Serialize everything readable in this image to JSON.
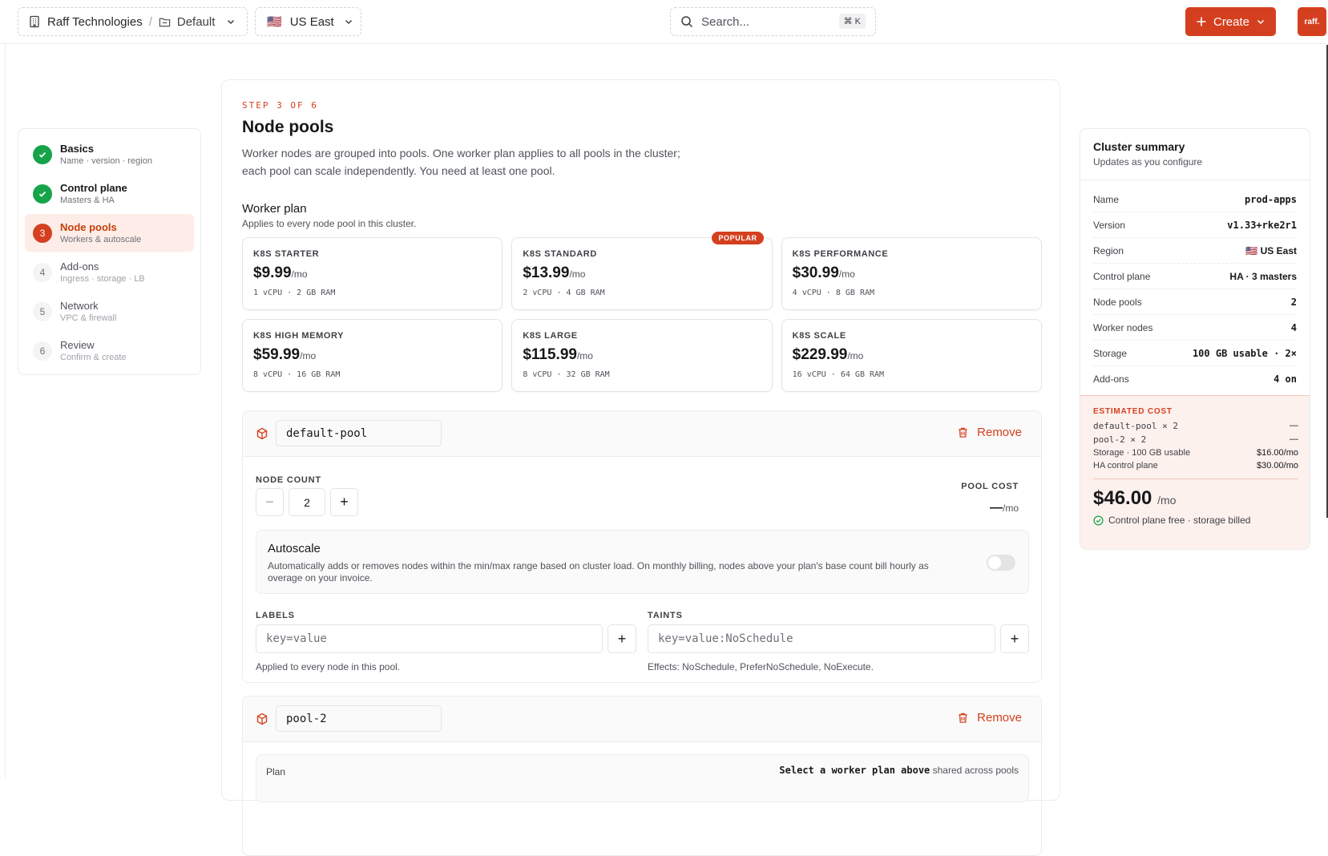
{
  "header": {
    "org": "Raff Technologies",
    "project": "Default",
    "region_flag": "🇺🇸",
    "region": "US East",
    "search_placeholder": "Search...",
    "search_shortcut": "⌘ K",
    "create_label": "Create",
    "logo_text": "raff."
  },
  "steps": [
    {
      "num": "✓",
      "title": "Basics",
      "sub": "Name · version · region",
      "state": "done"
    },
    {
      "num": "✓",
      "title": "Control plane",
      "sub": "Masters & HA",
      "state": "done"
    },
    {
      "num": "3",
      "title": "Node pools",
      "sub": "Workers & autoscale",
      "state": "current"
    },
    {
      "num": "4",
      "title": "Add-ons",
      "sub": "Ingress · storage · LB",
      "state": "todo"
    },
    {
      "num": "5",
      "title": "Network",
      "sub": "VPC & firewall",
      "state": "todo"
    },
    {
      "num": "6",
      "title": "Review",
      "sub": "Confirm & create",
      "state": "todo"
    }
  ],
  "main": {
    "eyebrow": "STEP 3 OF 6",
    "title": "Node pools",
    "description": "Worker nodes are grouped into pools. One worker plan applies to all pools in the cluster; each pool can scale independently. You need at least one pool.",
    "worker_plan_title": "Worker plan",
    "worker_plan_sub": "Applies to every node pool in this cluster.",
    "popular_label": "POPULAR",
    "plans": [
      {
        "name": "K8S STARTER",
        "price": "$9.99",
        "unit": "/mo",
        "spec": "1 vCPU · 2 GB RAM"
      },
      {
        "name": "K8S STANDARD",
        "price": "$13.99",
        "unit": "/mo",
        "spec": "2 vCPU · 4 GB RAM"
      },
      {
        "name": "K8S PERFORMANCE",
        "price": "$30.99",
        "unit": "/mo",
        "spec": "4 vCPU · 8 GB RAM"
      },
      {
        "name": "K8S HIGH MEMORY",
        "price": "$59.99",
        "unit": "/mo",
        "spec": "8 vCPU · 16 GB RAM"
      },
      {
        "name": "K8S LARGE",
        "price": "$115.99",
        "unit": "/mo",
        "spec": "8 vCPU · 32 GB RAM"
      },
      {
        "name": "K8S SCALE",
        "price": "$229.99",
        "unit": "/mo",
        "spec": "16 vCPU · 64 GB RAM"
      }
    ]
  },
  "pool1": {
    "name": "default-pool",
    "remove_label": "Remove",
    "node_count_label": "NODE COUNT",
    "node_count": "2",
    "pool_cost_label": "POOL COST",
    "pool_cost_value": "—",
    "pool_cost_unit": "/mo",
    "autoscale_title": "Autoscale",
    "autoscale_desc": "Automatically adds or removes nodes within the min/max range based on cluster load. On monthly billing, nodes above your plan's base count bill hourly as overage on your invoice.",
    "labels_label": "LABELS",
    "labels_placeholder": "key=value",
    "labels_hint": "Applied to every node in this pool.",
    "taints_label": "TAINTS",
    "taints_placeholder": "key=value:NoSchedule",
    "taints_hint": "Effects: NoSchedule, PreferNoSchedule, NoExecute."
  },
  "pool2": {
    "name": "pool-2",
    "remove_label": "Remove",
    "plan_label": "Plan",
    "plan_value": "Select a worker plan above",
    "plan_suffix": "shared across pools"
  },
  "summary": {
    "title": "Cluster summary",
    "subtitle": "Updates as you configure",
    "rows": [
      {
        "k": "Name",
        "v": "prod-apps"
      },
      {
        "k": "Version",
        "v": "v1.33+rke2r1"
      },
      {
        "k": "Region",
        "v": "🇺🇸 US East"
      },
      {
        "k": "Control plane",
        "v": "HA · 3 masters"
      },
      {
        "k": "Node pools",
        "v": "2"
      },
      {
        "k": "Worker nodes",
        "v": "4"
      },
      {
        "k": "Storage",
        "v": "100 GB usable · 2×"
      },
      {
        "k": "Add-ons",
        "v": "4 on"
      }
    ],
    "cost_title": "ESTIMATED COST",
    "cost_rows": [
      {
        "k": "default-pool × 2",
        "v": "—"
      },
      {
        "k": "pool-2 × 2",
        "v": "—"
      },
      {
        "k": "Storage · 100 GB usable",
        "v": "$16.00/mo"
      },
      {
        "k": "HA control plane",
        "v": "$30.00/mo"
      }
    ],
    "total": "$46.00",
    "total_unit": "/mo",
    "note": "Control plane free · storage billed"
  },
  "colors": {
    "accent": "#d4401f",
    "success": "#16a34a"
  }
}
